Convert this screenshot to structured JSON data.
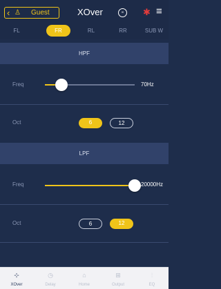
{
  "header": {
    "back_glyph": "‹",
    "user_glyph": "♙",
    "user_label": "Guest",
    "title": "XOver",
    "circle_icon_text": "∞",
    "bluetooth_glyph": "✱",
    "menu_glyph": "≡"
  },
  "tabs": [
    {
      "label": "FL",
      "active": false
    },
    {
      "label": "FR",
      "active": true
    },
    {
      "label": "RL",
      "active": false
    },
    {
      "label": "RR",
      "active": false
    },
    {
      "label": "SUB W",
      "active": false
    }
  ],
  "hpf": {
    "title": "HPF",
    "freq_label": "Freq",
    "freq_value": "70Hz",
    "oct_label": "Oct",
    "oct_options": [
      "6",
      "12"
    ],
    "oct_selected": "6"
  },
  "lpf": {
    "title": "LPF",
    "freq_label": "Freq",
    "freq_value": "20000Hz",
    "oct_label": "Oct",
    "oct_options": [
      "6",
      "12"
    ],
    "oct_selected": "12"
  },
  "bottom_nav": [
    {
      "label": "XOver",
      "icon": "crossover-icon",
      "glyph": "⊹",
      "active": true
    },
    {
      "label": "Delay",
      "icon": "clock-icon",
      "glyph": "◷",
      "active": false
    },
    {
      "label": "Home",
      "icon": "home-icon",
      "glyph": "⌂",
      "active": false
    },
    {
      "label": "Output",
      "icon": "grid-icon",
      "glyph": "⊞",
      "active": false
    },
    {
      "label": "EQ",
      "icon": "equalizer-icon",
      "glyph": "⫶",
      "active": false
    }
  ],
  "colors": {
    "accent": "#f0c419",
    "background": "#1e2d4b",
    "header": "#31426a",
    "bluetooth": "#e23b3b",
    "nav_active": "#2b3a5c",
    "nav_inactive": "#b9bfcc"
  }
}
